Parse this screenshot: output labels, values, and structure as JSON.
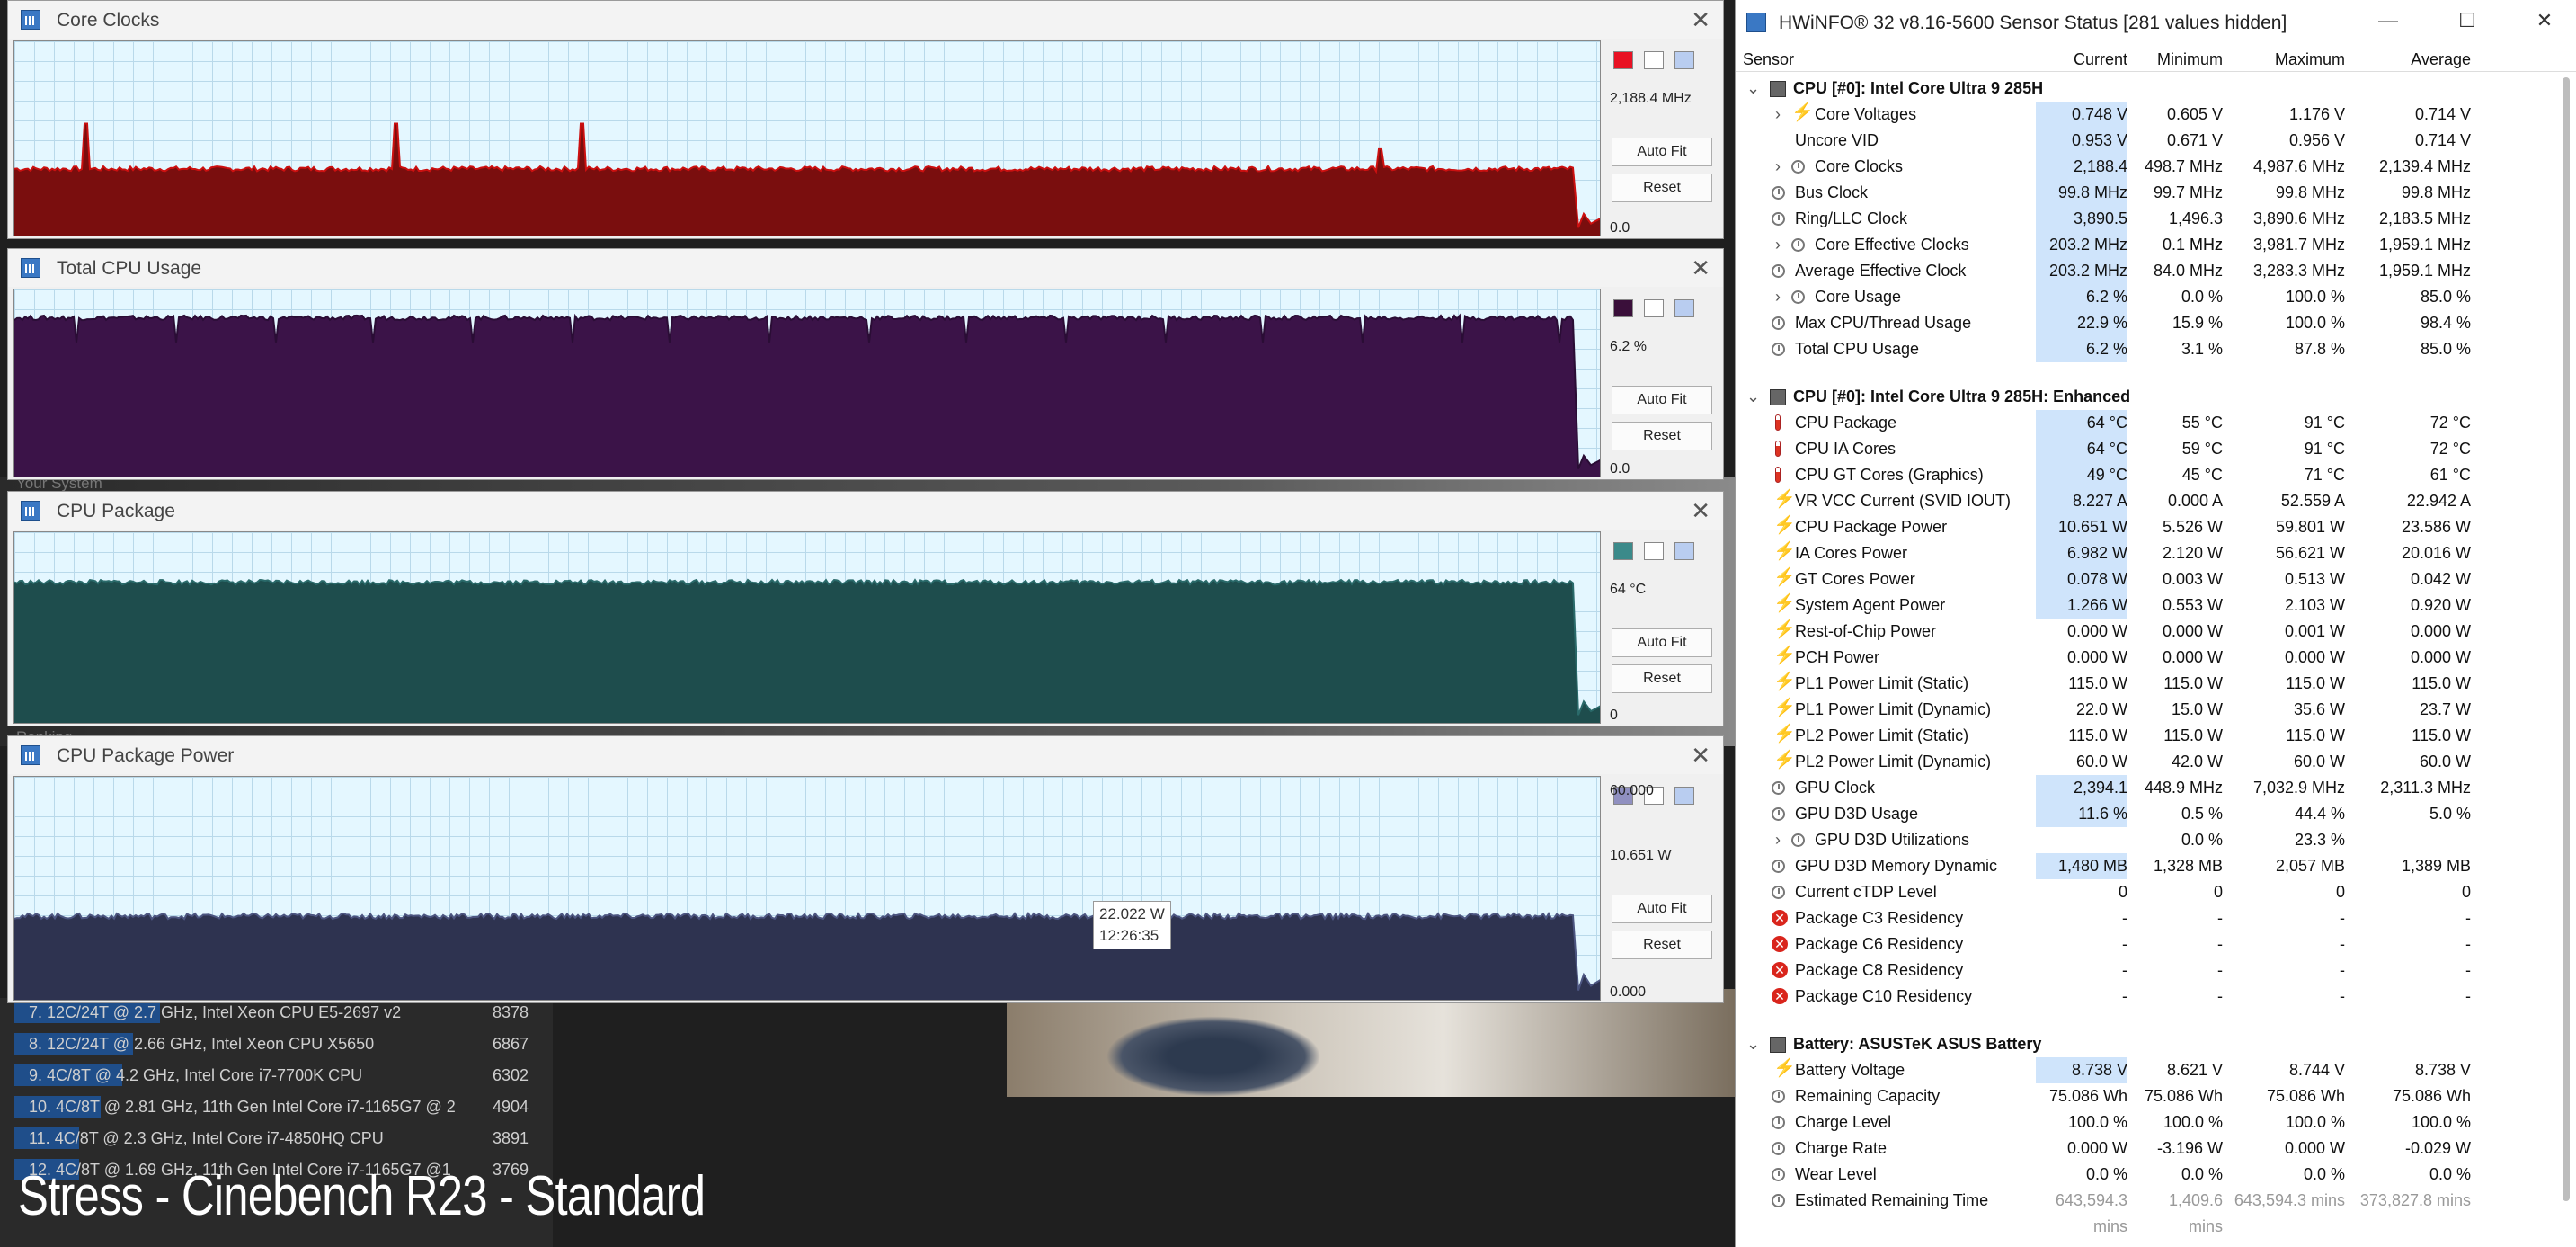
{
  "graphs": [
    {
      "title": "Core Clocks",
      "swatch": "#e81123",
      "values": [
        "2,188.4 MHz",
        "0.0"
      ],
      "fill": "#7a0e0e",
      "stroke": "#cc1010",
      "level": 0.35,
      "spikes": [
        {
          "at": 0.045,
          "h": 0.58
        },
        {
          "at": 0.24,
          "h": 0.58
        },
        {
          "at": 0.358,
          "h": 0.58
        },
        {
          "at": 0.86,
          "h": 0.45
        }
      ],
      "dip": false
    },
    {
      "title": "Total CPU Usage",
      "swatch": "#3a0f3a",
      "values": [
        "6.2 %",
        "0.0"
      ],
      "fill": "#3b1348",
      "stroke": "#2a0d35",
      "level": 0.85,
      "spikes": [],
      "dip": true
    },
    {
      "title": "CPU Package",
      "swatch": "#3b8a8a",
      "values": [
        "64 °C",
        "0"
      ],
      "fill": "#1e4d4d",
      "stroke": "#2a6a6a",
      "level": 0.74,
      "spikes": [],
      "dip": false
    },
    {
      "title": "CPU Package Power",
      "swatch": "#9090c0",
      "values": [
        "60.000",
        "10.651 W",
        "0.000"
      ],
      "fill": "#2e3350",
      "stroke": "#4c5580",
      "level": 0.38,
      "spikes": [],
      "dip": false
    }
  ],
  "buttons": {
    "autofit": "Auto Fit",
    "reset": "Reset"
  },
  "tooltip": {
    "value": "22.022 W",
    "time": "12:26:35"
  },
  "background": {
    "your_system": "Your System",
    "ranking": "Ranking",
    "cb_rows": [
      {
        "label": "7. 12C/24T @ 2.7 GHz, Intel Xeon CPU E5-2697 v2",
        "score": "8378",
        "bar": 0.27
      },
      {
        "label": "8. 12C/24T @ 2.66 GHz, Intel Xeon CPU X5650",
        "score": "6867",
        "bar": 0.22
      },
      {
        "label": "9. 4C/8T @ 4.2 GHz, Intel Core i7-7700K CPU",
        "score": "6302",
        "bar": 0.2
      },
      {
        "label": "10. 4C/8T @ 2.81 GHz, 11th Gen Intel Core i7-1165G7 @ 2",
        "score": "4904",
        "bar": 0.16
      },
      {
        "label": "11. 4C/8T @ 2.3 GHz, Intel Core i7-4850HQ CPU",
        "score": "3891",
        "bar": 0.12
      },
      {
        "label": "12. 4C/8T @ 1.69 GHz, 11th Gen Intel Core i7-1165G7 @1",
        "score": "3769",
        "bar": 0.12
      }
    ],
    "stress": "Stress - Cinebench R23 - Standard"
  },
  "hwinfo": {
    "title": "HWiNFO® 32 v8.16-5600 Sensor Status [281 values hidden]",
    "columns": [
      "Sensor",
      "Current",
      "Minimum",
      "Maximum",
      "Average"
    ],
    "rows": [
      {
        "t": "grp",
        "name": "CPU [#0]: Intel Core Ultra 9 285H"
      },
      {
        "t": "row",
        "icon": "bolt",
        "exp": true,
        "name": "Core Voltages",
        "v": [
          "0.748 V",
          "0.605 V",
          "1.176 V",
          "0.714 V"
        ],
        "hl": true
      },
      {
        "t": "row",
        "icon": "none",
        "name": "Uncore VID",
        "v": [
          "0.953 V",
          "0.671 V",
          "0.956 V",
          "0.714 V"
        ],
        "hl": true
      },
      {
        "t": "row",
        "icon": "clk",
        "exp": true,
        "name": "Core Clocks",
        "v": [
          "2,188.4 MHz",
          "498.7 MHz",
          "4,987.6 MHz",
          "2,139.4 MHz"
        ],
        "hl": true
      },
      {
        "t": "row",
        "icon": "clk",
        "name": "Bus Clock",
        "v": [
          "99.8 MHz",
          "99.7 MHz",
          "99.8 MHz",
          "99.8 MHz"
        ],
        "hl": true
      },
      {
        "t": "row",
        "icon": "clk",
        "name": "Ring/LLC Clock",
        "v": [
          "3,890.5 MHz",
          "1,496.3 MHz",
          "3,890.6 MHz",
          "2,183.5 MHz"
        ],
        "hl": true
      },
      {
        "t": "row",
        "icon": "clk",
        "exp": true,
        "name": "Core Effective Clocks",
        "v": [
          "203.2 MHz",
          "0.1 MHz",
          "3,981.7 MHz",
          "1,959.1 MHz"
        ],
        "hl": true
      },
      {
        "t": "row",
        "icon": "clk",
        "name": "Average Effective Clock",
        "v": [
          "203.2 MHz",
          "84.0 MHz",
          "3,283.3 MHz",
          "1,959.1 MHz"
        ],
        "hl": true
      },
      {
        "t": "row",
        "icon": "clk",
        "exp": true,
        "name": "Core Usage",
        "v": [
          "6.2 %",
          "0.0 %",
          "100.0 %",
          "85.0 %"
        ],
        "hl": true
      },
      {
        "t": "row",
        "icon": "clk",
        "name": "Max CPU/Thread Usage",
        "v": [
          "22.9 %",
          "15.9 %",
          "100.0 %",
          "98.4 %"
        ],
        "hl": true
      },
      {
        "t": "row",
        "icon": "clk",
        "name": "Total CPU Usage",
        "v": [
          "6.2 %",
          "3.1 %",
          "87.8 %",
          "85.0 %"
        ],
        "hl": true
      },
      {
        "t": "gap"
      },
      {
        "t": "grp",
        "name": "CPU [#0]: Intel Core Ultra 9 285H: Enhanced"
      },
      {
        "t": "row",
        "icon": "th",
        "name": "CPU Package",
        "v": [
          "64 °C",
          "55 °C",
          "91 °C",
          "72 °C"
        ],
        "hl": true
      },
      {
        "t": "row",
        "icon": "th",
        "name": "CPU IA Cores",
        "v": [
          "64 °C",
          "59 °C",
          "91 °C",
          "72 °C"
        ],
        "hl": true
      },
      {
        "t": "row",
        "icon": "th",
        "name": "CPU GT Cores (Graphics)",
        "v": [
          "49 °C",
          "45 °C",
          "71 °C",
          "61 °C"
        ],
        "hl": true
      },
      {
        "t": "row",
        "icon": "bolt",
        "name": "VR VCC Current (SVID IOUT)",
        "v": [
          "8.227 A",
          "0.000 A",
          "52.559 A",
          "22.942 A"
        ],
        "hl": true
      },
      {
        "t": "row",
        "icon": "bolt",
        "name": "CPU Package Power",
        "v": [
          "10.651 W",
          "5.526 W",
          "59.801 W",
          "23.586 W"
        ],
        "hl": true
      },
      {
        "t": "row",
        "icon": "bolt",
        "name": "IA Cores Power",
        "v": [
          "6.982 W",
          "2.120 W",
          "56.621 W",
          "20.016 W"
        ],
        "hl": true
      },
      {
        "t": "row",
        "icon": "bolt",
        "name": "GT Cores Power",
        "v": [
          "0.078 W",
          "0.003 W",
          "0.513 W",
          "0.042 W"
        ],
        "hl": true
      },
      {
        "t": "row",
        "icon": "bolt",
        "name": "System Agent Power",
        "v": [
          "1.266 W",
          "0.553 W",
          "2.103 W",
          "0.920 W"
        ],
        "hl": true
      },
      {
        "t": "row",
        "icon": "bolt",
        "name": "Rest-of-Chip Power",
        "v": [
          "0.000 W",
          "0.000 W",
          "0.001 W",
          "0.000 W"
        ],
        "hl": false
      },
      {
        "t": "row",
        "icon": "bolt",
        "name": "PCH Power",
        "v": [
          "0.000 W",
          "0.000 W",
          "0.000 W",
          "0.000 W"
        ],
        "hl": false
      },
      {
        "t": "row",
        "icon": "bolt",
        "name": "PL1 Power Limit (Static)",
        "v": [
          "115.0 W",
          "115.0 W",
          "115.0 W",
          "115.0 W"
        ],
        "hl": false
      },
      {
        "t": "row",
        "icon": "bolt",
        "name": "PL1 Power Limit (Dynamic)",
        "v": [
          "22.0 W",
          "15.0 W",
          "35.6 W",
          "23.7 W"
        ],
        "hl": false
      },
      {
        "t": "row",
        "icon": "bolt",
        "name": "PL2 Power Limit (Static)",
        "v": [
          "115.0 W",
          "115.0 W",
          "115.0 W",
          "115.0 W"
        ],
        "hl": false
      },
      {
        "t": "row",
        "icon": "bolt",
        "name": "PL2 Power Limit (Dynamic)",
        "v": [
          "60.0 W",
          "42.0 W",
          "60.0 W",
          "60.0 W"
        ],
        "hl": false
      },
      {
        "t": "row",
        "icon": "clk",
        "name": "GPU Clock",
        "v": [
          "2,394.1 MHz",
          "448.9 MHz",
          "7,032.9 MHz",
          "2,311.3 MHz"
        ],
        "hl": true
      },
      {
        "t": "row",
        "icon": "clk",
        "name": "GPU D3D Usage",
        "v": [
          "11.6 %",
          "0.5 %",
          "44.4 %",
          "5.0 %"
        ],
        "hl": true
      },
      {
        "t": "row",
        "icon": "clk",
        "exp": true,
        "name": "GPU D3D Utilizations",
        "v": [
          "",
          "0.0 %",
          "23.3 %",
          ""
        ],
        "hl": false
      },
      {
        "t": "row",
        "icon": "clk",
        "name": "GPU D3D Memory Dynamic",
        "v": [
          "1,480 MB",
          "1,328 MB",
          "2,057 MB",
          "1,389 MB"
        ],
        "hl": true
      },
      {
        "t": "row",
        "icon": "clk",
        "name": "Current cTDP Level",
        "v": [
          "0",
          "0",
          "0",
          "0"
        ],
        "hl": false
      },
      {
        "t": "row",
        "icon": "err",
        "name": "Package C3 Residency",
        "v": [
          "-",
          "-",
          "-",
          "-"
        ],
        "hl": false
      },
      {
        "t": "row",
        "icon": "err",
        "name": "Package C6 Residency",
        "v": [
          "-",
          "-",
          "-",
          "-"
        ],
        "hl": false
      },
      {
        "t": "row",
        "icon": "err",
        "name": "Package C8 Residency",
        "v": [
          "-",
          "-",
          "-",
          "-"
        ],
        "hl": false
      },
      {
        "t": "row",
        "icon": "err",
        "name": "Package C10 Residency",
        "v": [
          "-",
          "-",
          "-",
          "-"
        ],
        "hl": false
      },
      {
        "t": "gap"
      },
      {
        "t": "grp",
        "name": "Battery: ASUSTeK ASUS Battery"
      },
      {
        "t": "row",
        "icon": "bolt",
        "name": "Battery Voltage",
        "v": [
          "8.738 V",
          "8.621 V",
          "8.744 V",
          "8.738 V"
        ],
        "hl": true
      },
      {
        "t": "row",
        "icon": "clk",
        "name": "Remaining Capacity",
        "v": [
          "75.086 Wh",
          "75.086 Wh",
          "75.086 Wh",
          "75.086 Wh"
        ],
        "hl": false
      },
      {
        "t": "row",
        "icon": "clk",
        "name": "Charge Level",
        "v": [
          "100.0 %",
          "100.0 %",
          "100.0 %",
          "100.0 %"
        ],
        "hl": false
      },
      {
        "t": "row",
        "icon": "clk",
        "name": "Charge Rate",
        "v": [
          "0.000 W",
          "-3.196 W",
          "0.000 W",
          "-0.029 W"
        ],
        "hl": false
      },
      {
        "t": "row",
        "icon": "clk",
        "name": "Wear Level",
        "v": [
          "0.0 %",
          "0.0 %",
          "0.0 %",
          "0.0 %"
        ],
        "hl": false
      },
      {
        "t": "row",
        "icon": "clk",
        "name": "Estimated Remaining Time",
        "v": [
          "643,594.3 mins",
          "1,409.6 mins",
          "643,594.3 mins",
          "373,827.8 mins"
        ],
        "hl": false,
        "dim": true
      }
    ]
  }
}
